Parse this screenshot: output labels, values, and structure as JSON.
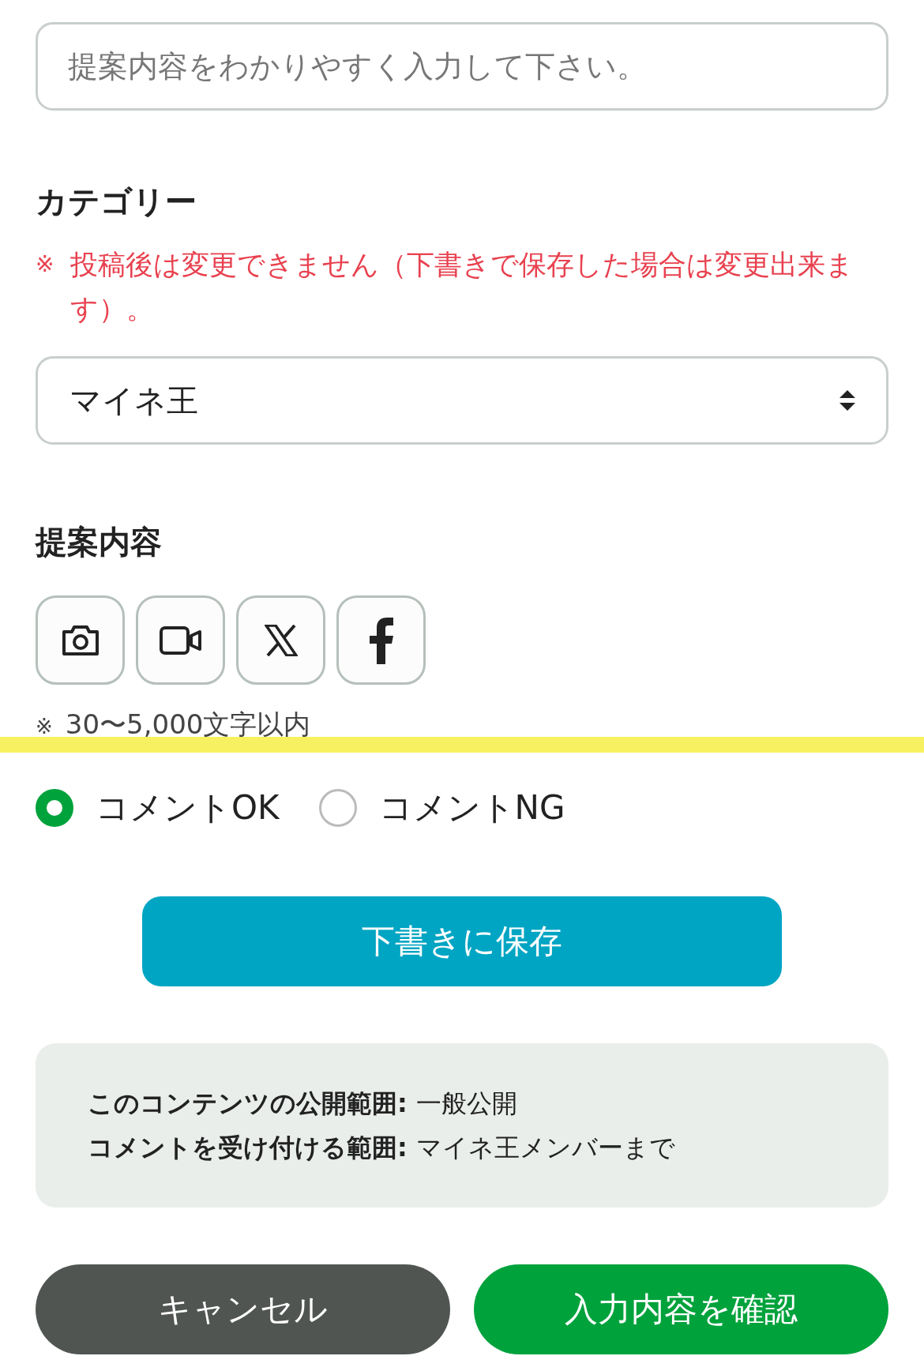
{
  "title_field": {
    "placeholder": "提案内容をわかりやすく入力して下さい。"
  },
  "category": {
    "heading": "カテゴリー",
    "note_mark": "※",
    "note": "投稿後は変更できません（下書きで保存した場合は変更出来ます）。",
    "select_value": "マイネ王"
  },
  "content": {
    "heading": "提案内容",
    "tools": [
      {
        "kind": "camera"
      },
      {
        "kind": "video"
      },
      {
        "kind": "x"
      },
      {
        "kind": "facebook"
      }
    ],
    "limit_mark": "※",
    "limit": "30〜5,000文字以内"
  },
  "comment_options": [
    {
      "label": "コメントOK",
      "selected": true
    },
    {
      "label": "コメントNG",
      "selected": false
    }
  ],
  "save_draft_button": "下書きに保存",
  "info": [
    {
      "label": "このコンテンツの公開範囲:",
      "value": "一般公開"
    },
    {
      "label": "コメントを受け付ける範囲:",
      "value": "マイネ王メンバーまで"
    }
  ],
  "buttons": {
    "cancel": "キャンセル",
    "confirm": "入力内容を確認"
  }
}
